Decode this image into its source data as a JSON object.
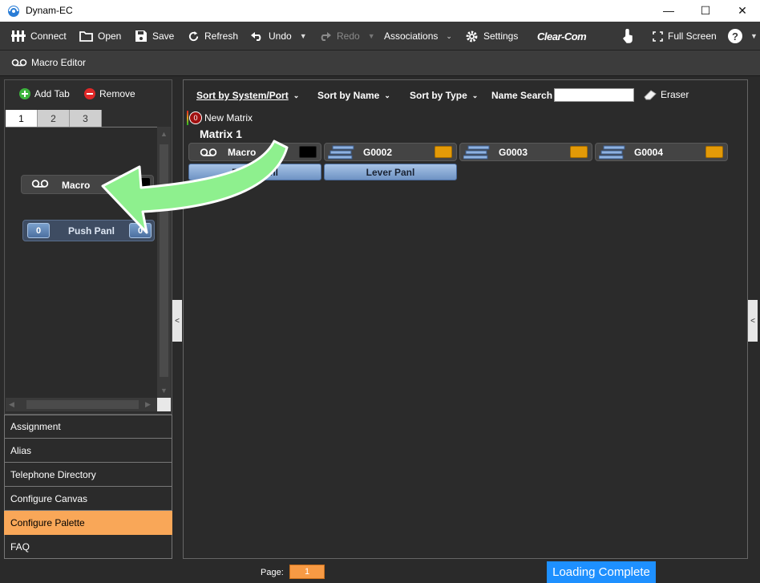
{
  "window": {
    "title": "Dynam-EC",
    "minimize_glyph": "—",
    "maximize_glyph": "☐",
    "close_glyph": "✕"
  },
  "toolbar": {
    "connect": "Connect",
    "open": "Open",
    "save": "Save",
    "refresh": "Refresh",
    "undo": "Undo",
    "redo": "Redo",
    "associations": "Associations",
    "settings": "Settings",
    "brand": "Clear-Com",
    "full_screen": "Full Screen",
    "help_glyph": "?"
  },
  "subbar": {
    "label": "Macro Editor"
  },
  "left_panel": {
    "add_tab": "Add Tab",
    "remove": "Remove",
    "tabs": [
      {
        "label": "1",
        "active": true
      },
      {
        "label": "2",
        "active": false
      },
      {
        "label": "3",
        "active": false
      }
    ],
    "macro_tile": {
      "label": "Macro"
    },
    "push_tile": {
      "label": "Push Panl",
      "left_num": "0",
      "right_num": "0"
    }
  },
  "menu": [
    {
      "label": "Assignment",
      "active": false
    },
    {
      "label": "Alias",
      "active": false
    },
    {
      "label": "Telephone Directory",
      "active": false
    },
    {
      "label": "Configure Canvas",
      "active": false
    },
    {
      "label": "Configure Palette",
      "active": true
    },
    {
      "label": "FAQ",
      "active": false
    }
  ],
  "main": {
    "sort_system_port": "Sort by System/Port",
    "sort_name": "Sort by Name",
    "sort_type": "Sort by Type",
    "name_search_label": "Name Search",
    "name_search_value": "",
    "eraser": "Eraser",
    "new_matrix": "New Matrix",
    "new_matrix_count": "0",
    "matrix_title": "Matrix 1",
    "tiles": [
      {
        "label": "Macro",
        "swatch": "black",
        "icon": "macro-icon"
      },
      {
        "label": "G0002",
        "swatch": "orange",
        "icon": "panel-icon"
      },
      {
        "label": "G0003",
        "swatch": "orange",
        "icon": "panel-icon"
      },
      {
        "label": "G0004",
        "swatch": "orange",
        "icon": "panel-icon"
      }
    ],
    "panel_tiles": [
      {
        "label": "Push Panl"
      },
      {
        "label": "Lever Panl"
      }
    ]
  },
  "status": {
    "page_label": "Page:",
    "page_value": "1",
    "loading": "Loading Complete"
  },
  "colors": {
    "accent_orange": "#f9a758",
    "swatch_orange": "#e39a07",
    "loading_blue": "#1e90ff",
    "arrow_green": "#8ef08e"
  },
  "handles": {
    "left_glyph": "<",
    "right_glyph": "<"
  }
}
